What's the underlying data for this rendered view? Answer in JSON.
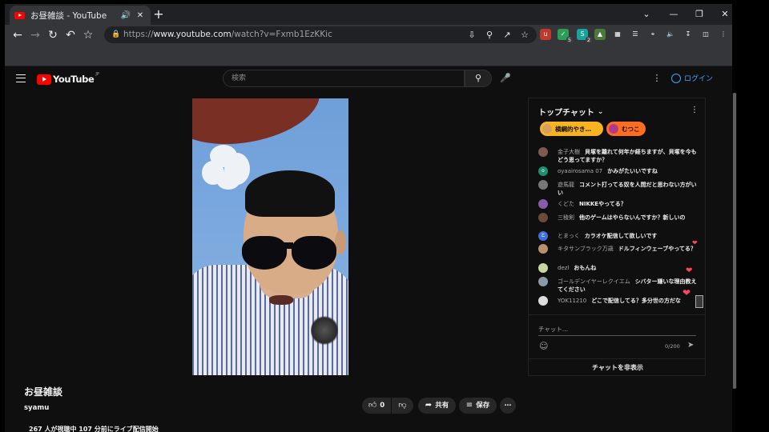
{
  "browser": {
    "tab_title": "お昼雑談 - YouTube",
    "tab_audio_icon": "speaker-icon",
    "tab_close": "✕",
    "new_tab": "+",
    "window": {
      "minimize": "⌄",
      "restore": "—",
      "maximize": "❐",
      "close": "✕"
    },
    "url_scheme": "https://",
    "url_host": "www.youtube.com",
    "url_path": "/watch?v=Fxmb1EzKKic",
    "ext_badges": {
      "shield": "5",
      "s": "2"
    }
  },
  "header": {
    "logo_text": "YouTube",
    "logo_region": "JP",
    "search_placeholder": "検索",
    "login_label": "ログイン"
  },
  "video": {
    "title": "お昼雑談",
    "channel": "syamu",
    "like_count": "0",
    "share_label": "共有",
    "save_label": "保存",
    "stats": "267 人が視聴中  107 分前にライブ配信開始"
  },
  "chat": {
    "header": "トップチャット",
    "tickers": [
      {
        "text": "横綱的やき…",
        "color": "#f8b323"
      },
      {
        "text": "むつこ",
        "color": "#ff6d1f"
      }
    ],
    "messages": [
      {
        "author": "金子大樹",
        "text": "貝塚を離れて何年か経ちますが、貝塚を今もどう思ってますか？",
        "avatar": "#7d5a4f"
      },
      {
        "author": "oyaairosama 07",
        "text": "かみがたいいですね",
        "avatar": "#1e8e6e",
        "initial": "o"
      },
      {
        "author": "遊馬龍",
        "text": "コメント打ってる奴を人間だと思わない方がいい",
        "avatar": "#777"
      },
      {
        "author": "くどた",
        "text": "NIKKEやってる？",
        "avatar": "#8a5ba8"
      },
      {
        "author": "三稜剣",
        "text": "他のゲームはやらないんですか？新しいの",
        "avatar": "#6b4a3a"
      },
      {
        "author": "とまっく",
        "text": "カラオケ配信して欲しいです",
        "avatar": "#3f6fd8",
        "initial": "と"
      },
      {
        "author": "キタサンブラック万歳",
        "text": "ドルフィンウェーブやってる？",
        "avatar": "#b8926a"
      },
      {
        "author": "dezl",
        "text": "おもんね",
        "avatar": "#c9d6a0"
      },
      {
        "author": "ゴールデンイヤーレクイエム",
        "text": "シバター嫌いな理由教えてください",
        "avatar": "#8899aa"
      },
      {
        "author": "YOK11210",
        "text": "どこで配信してる？多分世の方だな",
        "avatar": "#ddd"
      }
    ],
    "input_placeholder": "チャット...",
    "counter": "0/200",
    "hide_label": "チャットを非表示"
  },
  "colors": {
    "accent": "#3ea6ff",
    "brand": "#ff0000",
    "heart": "#ff4757"
  }
}
